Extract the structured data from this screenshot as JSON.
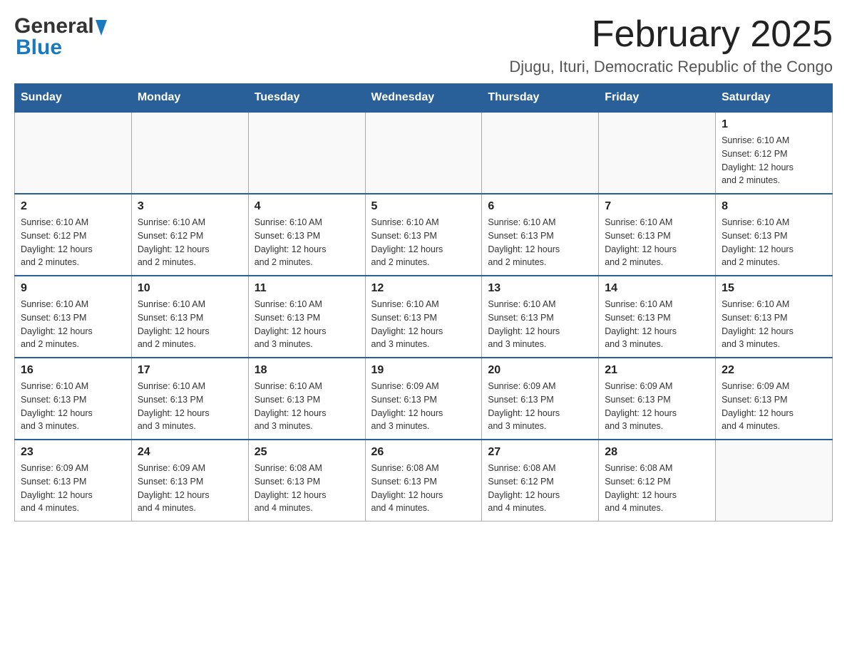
{
  "header": {
    "logo": {
      "general": "General",
      "blue": "Blue"
    },
    "month_title": "February 2025",
    "location": "Djugu, Ituri, Democratic Republic of the Congo"
  },
  "weekdays": [
    "Sunday",
    "Monday",
    "Tuesday",
    "Wednesday",
    "Thursday",
    "Friday",
    "Saturday"
  ],
  "weeks": [
    [
      {
        "day": "",
        "info": ""
      },
      {
        "day": "",
        "info": ""
      },
      {
        "day": "",
        "info": ""
      },
      {
        "day": "",
        "info": ""
      },
      {
        "day": "",
        "info": ""
      },
      {
        "day": "",
        "info": ""
      },
      {
        "day": "1",
        "info": "Sunrise: 6:10 AM\nSunset: 6:12 PM\nDaylight: 12 hours\nand 2 minutes."
      }
    ],
    [
      {
        "day": "2",
        "info": "Sunrise: 6:10 AM\nSunset: 6:12 PM\nDaylight: 12 hours\nand 2 minutes."
      },
      {
        "day": "3",
        "info": "Sunrise: 6:10 AM\nSunset: 6:12 PM\nDaylight: 12 hours\nand 2 minutes."
      },
      {
        "day": "4",
        "info": "Sunrise: 6:10 AM\nSunset: 6:13 PM\nDaylight: 12 hours\nand 2 minutes."
      },
      {
        "day": "5",
        "info": "Sunrise: 6:10 AM\nSunset: 6:13 PM\nDaylight: 12 hours\nand 2 minutes."
      },
      {
        "day": "6",
        "info": "Sunrise: 6:10 AM\nSunset: 6:13 PM\nDaylight: 12 hours\nand 2 minutes."
      },
      {
        "day": "7",
        "info": "Sunrise: 6:10 AM\nSunset: 6:13 PM\nDaylight: 12 hours\nand 2 minutes."
      },
      {
        "day": "8",
        "info": "Sunrise: 6:10 AM\nSunset: 6:13 PM\nDaylight: 12 hours\nand 2 minutes."
      }
    ],
    [
      {
        "day": "9",
        "info": "Sunrise: 6:10 AM\nSunset: 6:13 PM\nDaylight: 12 hours\nand 2 minutes."
      },
      {
        "day": "10",
        "info": "Sunrise: 6:10 AM\nSunset: 6:13 PM\nDaylight: 12 hours\nand 2 minutes."
      },
      {
        "day": "11",
        "info": "Sunrise: 6:10 AM\nSunset: 6:13 PM\nDaylight: 12 hours\nand 3 minutes."
      },
      {
        "day": "12",
        "info": "Sunrise: 6:10 AM\nSunset: 6:13 PM\nDaylight: 12 hours\nand 3 minutes."
      },
      {
        "day": "13",
        "info": "Sunrise: 6:10 AM\nSunset: 6:13 PM\nDaylight: 12 hours\nand 3 minutes."
      },
      {
        "day": "14",
        "info": "Sunrise: 6:10 AM\nSunset: 6:13 PM\nDaylight: 12 hours\nand 3 minutes."
      },
      {
        "day": "15",
        "info": "Sunrise: 6:10 AM\nSunset: 6:13 PM\nDaylight: 12 hours\nand 3 minutes."
      }
    ],
    [
      {
        "day": "16",
        "info": "Sunrise: 6:10 AM\nSunset: 6:13 PM\nDaylight: 12 hours\nand 3 minutes."
      },
      {
        "day": "17",
        "info": "Sunrise: 6:10 AM\nSunset: 6:13 PM\nDaylight: 12 hours\nand 3 minutes."
      },
      {
        "day": "18",
        "info": "Sunrise: 6:10 AM\nSunset: 6:13 PM\nDaylight: 12 hours\nand 3 minutes."
      },
      {
        "day": "19",
        "info": "Sunrise: 6:09 AM\nSunset: 6:13 PM\nDaylight: 12 hours\nand 3 minutes."
      },
      {
        "day": "20",
        "info": "Sunrise: 6:09 AM\nSunset: 6:13 PM\nDaylight: 12 hours\nand 3 minutes."
      },
      {
        "day": "21",
        "info": "Sunrise: 6:09 AM\nSunset: 6:13 PM\nDaylight: 12 hours\nand 3 minutes."
      },
      {
        "day": "22",
        "info": "Sunrise: 6:09 AM\nSunset: 6:13 PM\nDaylight: 12 hours\nand 4 minutes."
      }
    ],
    [
      {
        "day": "23",
        "info": "Sunrise: 6:09 AM\nSunset: 6:13 PM\nDaylight: 12 hours\nand 4 minutes."
      },
      {
        "day": "24",
        "info": "Sunrise: 6:09 AM\nSunset: 6:13 PM\nDaylight: 12 hours\nand 4 minutes."
      },
      {
        "day": "25",
        "info": "Sunrise: 6:08 AM\nSunset: 6:13 PM\nDaylight: 12 hours\nand 4 minutes."
      },
      {
        "day": "26",
        "info": "Sunrise: 6:08 AM\nSunset: 6:13 PM\nDaylight: 12 hours\nand 4 minutes."
      },
      {
        "day": "27",
        "info": "Sunrise: 6:08 AM\nSunset: 6:12 PM\nDaylight: 12 hours\nand 4 minutes."
      },
      {
        "day": "28",
        "info": "Sunrise: 6:08 AM\nSunset: 6:12 PM\nDaylight: 12 hours\nand 4 minutes."
      },
      {
        "day": "",
        "info": ""
      }
    ]
  ]
}
